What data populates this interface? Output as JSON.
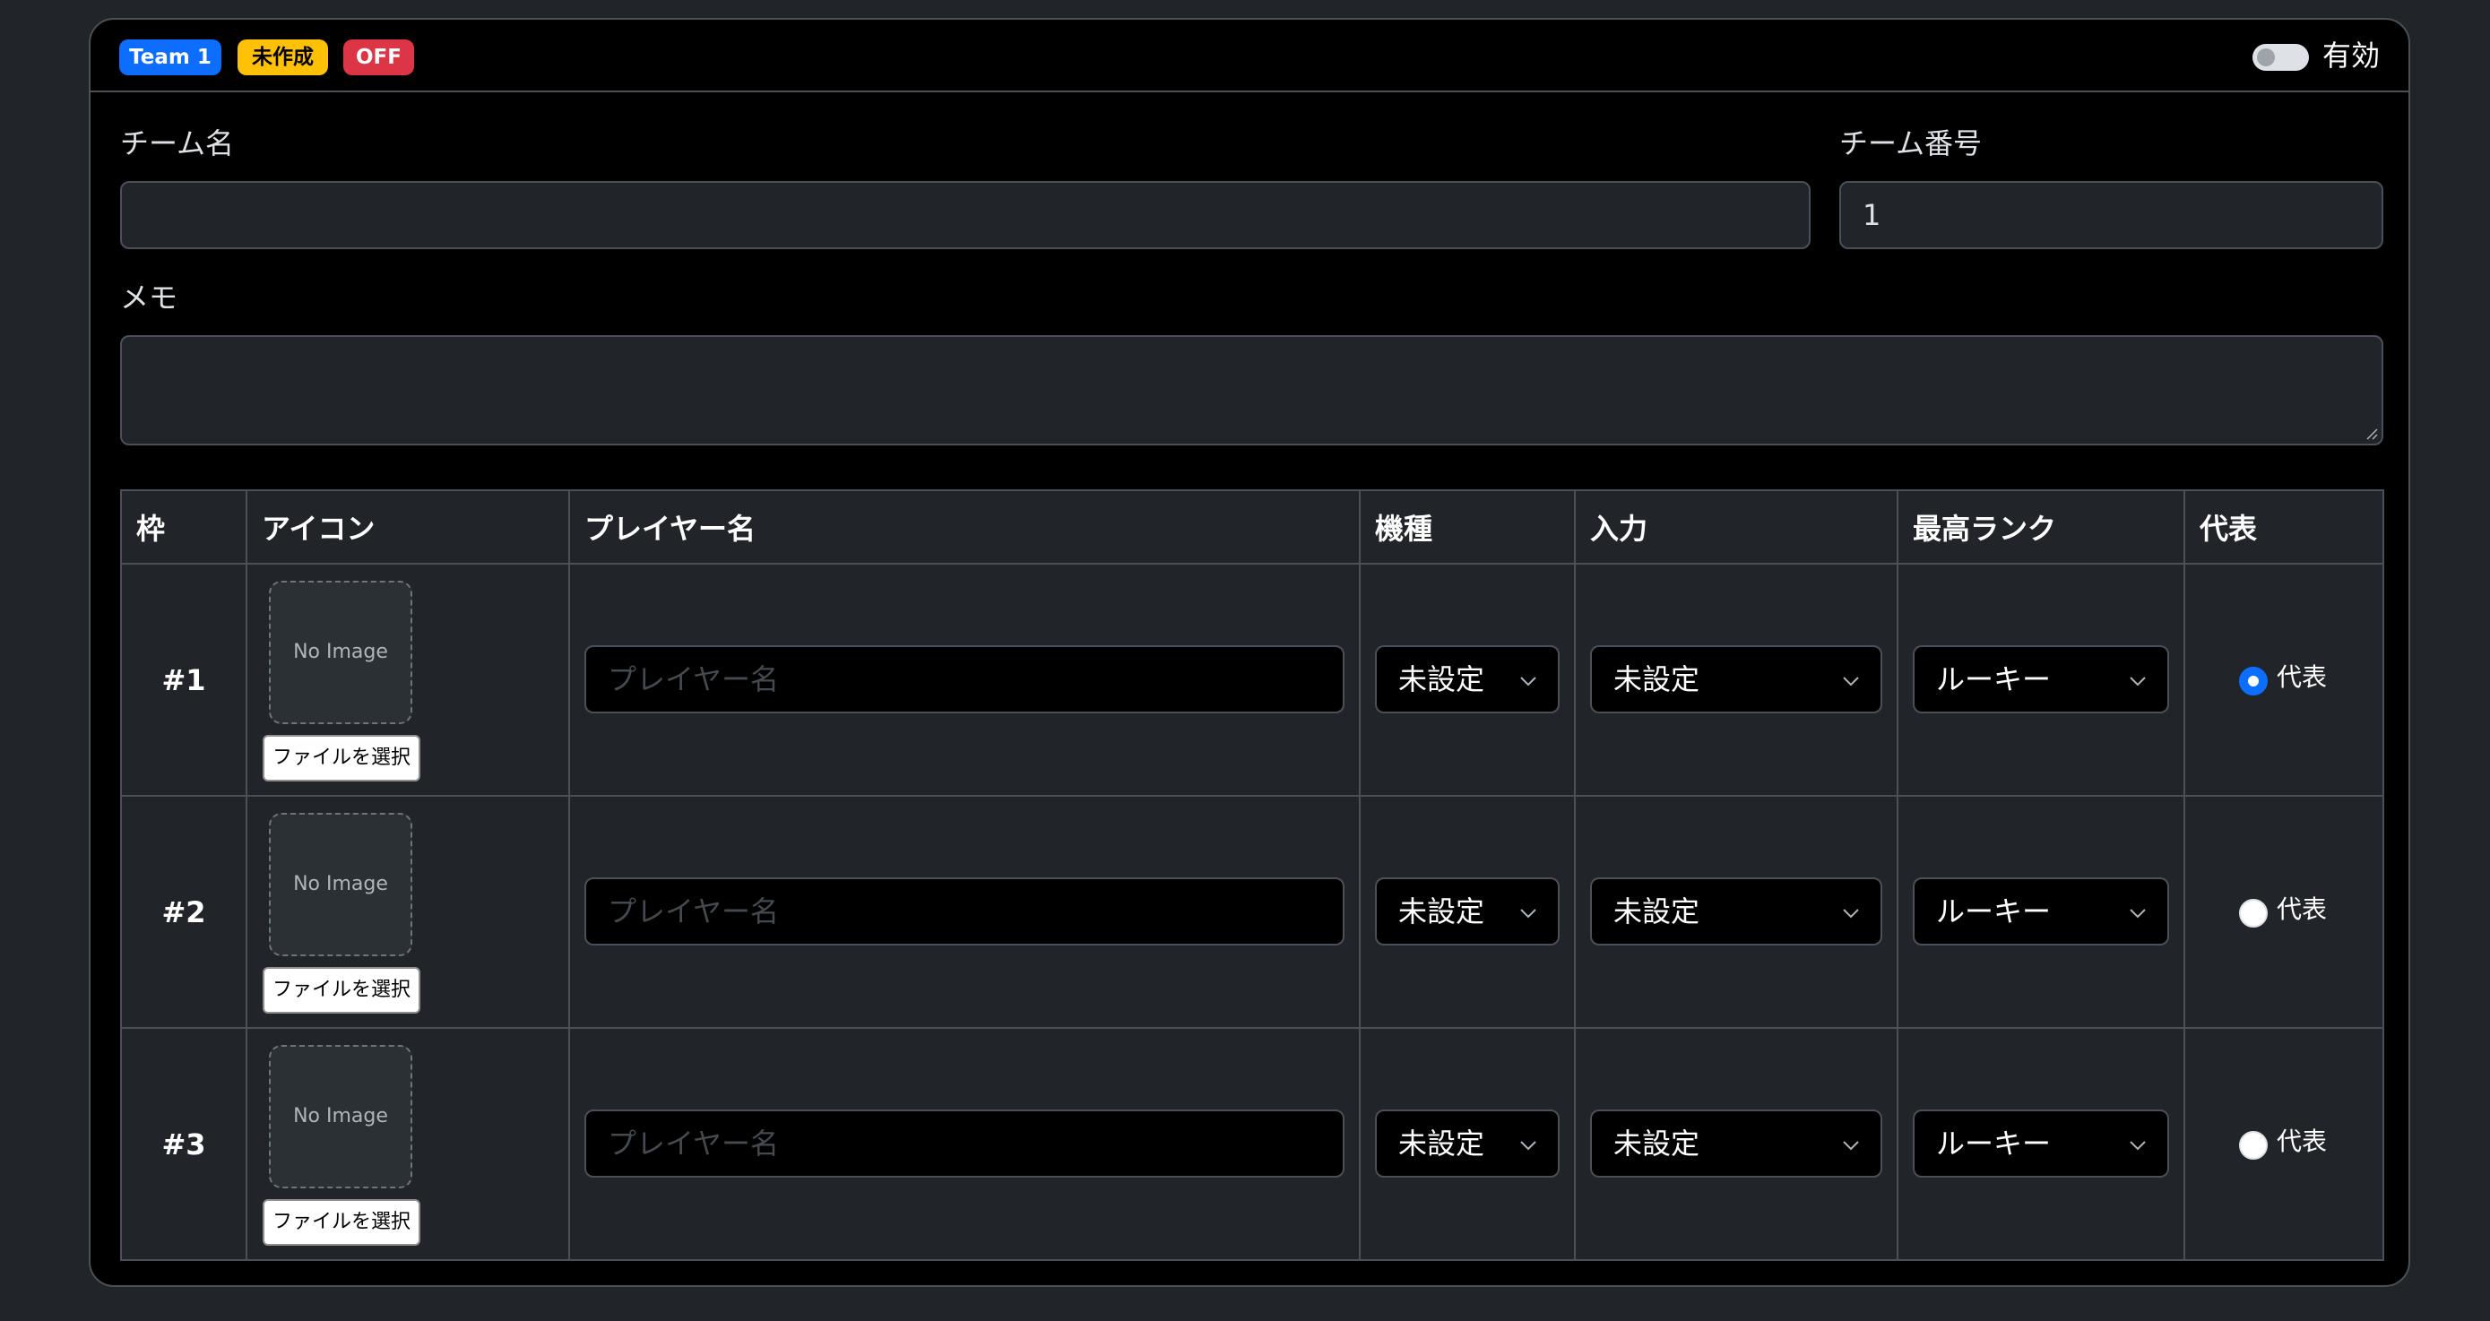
{
  "header": {
    "team_badge": "Team 1",
    "status_badge": "未作成",
    "off_badge": "OFF",
    "toggle_label": "有効",
    "colors": {
      "primary": "#0d6efd",
      "warning": "#ffc107",
      "danger": "#dc3545"
    }
  },
  "form": {
    "team_name_label": "チーム名",
    "team_name_value": "",
    "team_number_label": "チーム番号",
    "team_number_value": "1",
    "memo_label": "メモ",
    "memo_value": ""
  },
  "table": {
    "headers": [
      "枠",
      "アイコン",
      "プレイヤー名",
      "機種",
      "入力",
      "最高ランク",
      "代表"
    ],
    "rows": [
      {
        "slot": "#1",
        "no_image": "No Image",
        "file_button": "ファイルを選択",
        "name_placeholder": "プレイヤー名",
        "platform": "未設定",
        "input": "未設定",
        "rank": "ルーキー",
        "representative": "代表",
        "rep_checked": true
      },
      {
        "slot": "#2",
        "no_image": "No Image",
        "file_button": "ファイルを選択",
        "name_placeholder": "プレイヤー名",
        "platform": "未設定",
        "input": "未設定",
        "rank": "ルーキー",
        "representative": "代表",
        "rep_checked": false
      },
      {
        "slot": "#3",
        "no_image": "No Image",
        "file_button": "ファイルを選択",
        "name_placeholder": "プレイヤー名",
        "platform": "未設定",
        "input": "未設定",
        "rank": "ルーキー",
        "representative": "代表",
        "rep_checked": false
      }
    ]
  }
}
